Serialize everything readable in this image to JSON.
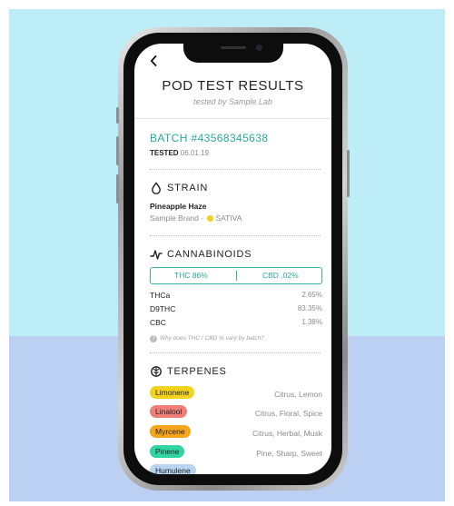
{
  "app": {
    "back_icon": "chevron-left-icon",
    "title": "POD TEST RESULTS",
    "subtitle": "tested by Sample Lab"
  },
  "batch": {
    "label": "BATCH #43568345638",
    "tested_label": "TESTED",
    "tested_date": "06.01.19"
  },
  "strain": {
    "section_title": "STRAIN",
    "section_icon": "droplet-icon",
    "name": "Pineapple Haze",
    "brand": "Sample Brand",
    "separator": "·",
    "type": "SATIVA",
    "type_color": "#f2cf1d"
  },
  "cannabinoids": {
    "section_title": "CANNABINOIDS",
    "section_icon": "pulse-icon",
    "toggle": {
      "thc": "THC 86%",
      "cbd": "CBD .02%"
    },
    "rows": [
      {
        "name": "THCa",
        "value": "2.65%"
      },
      {
        "name": "D9THC",
        "value": "83.35%"
      },
      {
        "name": "CBC",
        "value": "1.38%"
      }
    ],
    "help_icon": "question-circle-icon",
    "help_text": "Why does THC / CBD % vary by batch?"
  },
  "terpenes": {
    "section_title": "TERPENES",
    "section_icon": "leaf-icon",
    "items": [
      {
        "name": "Limonene",
        "desc": "Citrus, Lemon",
        "color": "#f3d31b"
      },
      {
        "name": "Linalool",
        "desc": "Citrus, Floral, Spice",
        "color": "#f07f7a"
      },
      {
        "name": "Myrcene",
        "desc": "Citrus, Herbal, Musk",
        "color": "#f6a51d"
      },
      {
        "name": "Pinene",
        "desc": "Pine, Sharp, Sweet",
        "color": "#2fd6a3"
      },
      {
        "name": "Humulene",
        "desc": "",
        "color": "#b8d4f2"
      }
    ]
  },
  "colors": {
    "accent": "#28a99b",
    "background_top": "#bdeef8",
    "background_bottom": "#bcd0f4"
  }
}
